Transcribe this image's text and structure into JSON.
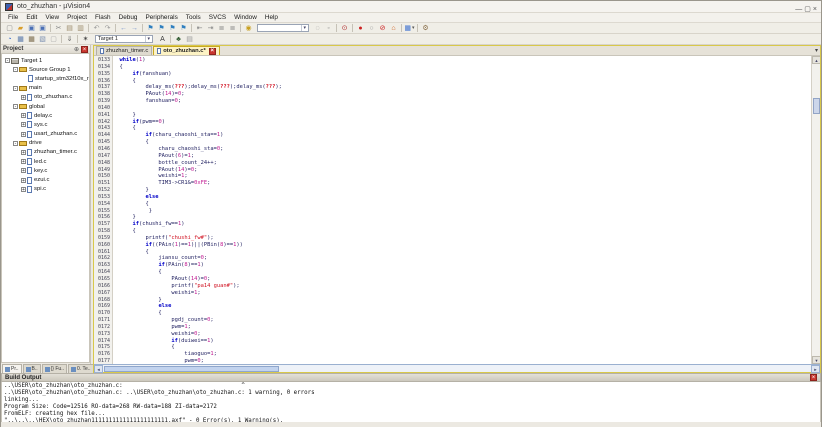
{
  "window": {
    "title": "oto_zhuzhan - µVision4",
    "controls": [
      {
        "name": "minimize",
        "glyph": "—"
      },
      {
        "name": "restore",
        "glyph": "▢"
      },
      {
        "name": "close",
        "glyph": "×"
      }
    ]
  },
  "menu": {
    "items": [
      "File",
      "Edit",
      "View",
      "Project",
      "Flash",
      "Debug",
      "Peripherals",
      "Tools",
      "SVCS",
      "Window",
      "Help"
    ]
  },
  "toolbar_main": {
    "icons_left": [
      {
        "name": "new-file",
        "glyph": "▢",
        "color": "#8a8a8a"
      },
      {
        "name": "open-folder",
        "glyph": "▰",
        "color": "#d99e2b"
      },
      {
        "name": "save",
        "glyph": "▣",
        "color": "#4a6fb5"
      },
      {
        "name": "save-all",
        "glyph": "▣",
        "color": "#4a6fb5"
      },
      {
        "sep": true
      },
      {
        "name": "cut",
        "glyph": "✂",
        "color": "#8a8a8a"
      },
      {
        "name": "copy",
        "glyph": "▤",
        "color": "#9a8a6a"
      },
      {
        "name": "paste",
        "glyph": "▥",
        "color": "#9a8a6a"
      },
      {
        "sep": true
      },
      {
        "name": "undo",
        "glyph": "↶",
        "color": "#9a9a9a"
      },
      {
        "name": "redo",
        "glyph": "↷",
        "color": "#9a9a9a"
      },
      {
        "sep": true
      },
      {
        "name": "navigate-back",
        "glyph": "←",
        "color": "#7b96cc"
      },
      {
        "name": "navigate-forward",
        "glyph": "→",
        "color": "#7b96cc"
      },
      {
        "sep": true
      },
      {
        "name": "toggle-bookmark",
        "glyph": "⚑",
        "color": "#2f7fbf"
      },
      {
        "name": "prev-bookmark",
        "glyph": "⚑",
        "color": "#2f7fbf"
      },
      {
        "name": "next-bookmark",
        "glyph": "⚑",
        "color": "#2f7fbf"
      },
      {
        "name": "clear-bookmarks",
        "glyph": "⚑",
        "color": "#2f7fbf"
      },
      {
        "sep": true
      },
      {
        "name": "unindent",
        "glyph": "⇤",
        "color": "#8a8a8a"
      },
      {
        "name": "indent",
        "glyph": "⇥",
        "color": "#8a8a8a"
      },
      {
        "name": "comment",
        "glyph": "≣",
        "color": "#8a8a8a"
      },
      {
        "name": "uncomment",
        "glyph": "≣",
        "color": "#8a8a8a"
      },
      {
        "sep": true
      },
      {
        "name": "find-in-files",
        "glyph": "◉",
        "color": "#c8a020"
      }
    ],
    "search_value": "",
    "icons_right": [
      {
        "name": "find-next",
        "glyph": "◌",
        "color": "#8a8a8a"
      },
      {
        "name": "incremental-find",
        "glyph": "◦",
        "color": "#8a8a8a"
      },
      {
        "sep": true
      },
      {
        "name": "find",
        "glyph": "⊙",
        "color": "#b03030"
      },
      {
        "sep": true
      },
      {
        "name": "insert-breakpoint",
        "glyph": "●",
        "color": "#cc2222"
      },
      {
        "name": "disable-breakpoint",
        "glyph": "○",
        "color": "#999999"
      },
      {
        "name": "kill-all-breakpoints",
        "glyph": "⊘",
        "color": "#cc2222"
      },
      {
        "name": "debug-session",
        "glyph": "⌂",
        "color": "#d06020"
      },
      {
        "sep": true
      },
      {
        "name": "debug-windows",
        "glyph": "▦",
        "color": "#3a6fd0",
        "dropdown": true
      },
      {
        "sep": true
      },
      {
        "name": "configure",
        "glyph": "⚙",
        "color": "#8a6f4a"
      }
    ]
  },
  "toolbar_build": {
    "icons_left": [
      {
        "name": "translate-file",
        "glyph": "◔",
        "color": "#3a6fd0"
      },
      {
        "name": "build",
        "glyph": "▦",
        "color": "#5577aa"
      },
      {
        "name": "rebuild-all",
        "glyph": "▦",
        "color": "#7a6a4a"
      },
      {
        "name": "batch-build",
        "glyph": "▧",
        "color": "#7a8fb0"
      },
      {
        "name": "stop-build",
        "glyph": "▢",
        "color": "#aaaaaa"
      },
      {
        "sep": true
      },
      {
        "name": "download-flash",
        "glyph": "⇓",
        "color": "#666666"
      },
      {
        "sep": true
      },
      {
        "name": "options-for-target",
        "glyph": "✶",
        "color": "#444444"
      }
    ],
    "target_value": "Target 1",
    "icons_right": [
      {
        "name": "edit-components",
        "glyph": "A",
        "color": "#3a3a3a"
      },
      {
        "sep": true
      },
      {
        "name": "debug-target",
        "glyph": "♣",
        "color": "#355e35"
      },
      {
        "name": "pack-installer",
        "glyph": "▤",
        "color": "#999999"
      }
    ]
  },
  "project_panel": {
    "title": "Project",
    "tree": [
      {
        "label": "Target 1",
        "depth": 0,
        "icon": "target",
        "expander": "minus"
      },
      {
        "label": "Source Group 1",
        "depth": 1,
        "icon": "folder",
        "expander": "minus"
      },
      {
        "label": "startup_stm32f10x_r",
        "depth": 2,
        "icon": "file",
        "expander": null
      },
      {
        "label": "main",
        "depth": 1,
        "icon": "folder",
        "expander": "minus"
      },
      {
        "label": "oto_zhuzhan.c",
        "depth": 2,
        "icon": "file",
        "expander": "plus"
      },
      {
        "label": "global",
        "depth": 1,
        "icon": "folder",
        "expander": "minus"
      },
      {
        "label": "delay.c",
        "depth": 2,
        "icon": "file",
        "expander": "plus"
      },
      {
        "label": "sys.c",
        "depth": 2,
        "icon": "file",
        "expander": "plus"
      },
      {
        "label": "usart_zhuzhan.c",
        "depth": 2,
        "icon": "file",
        "expander": "plus"
      },
      {
        "label": "drive",
        "depth": 1,
        "icon": "folder",
        "expander": "minus"
      },
      {
        "label": "zhuzhan_timer.c",
        "depth": 2,
        "icon": "file",
        "expander": "plus"
      },
      {
        "label": "led.c",
        "depth": 2,
        "icon": "file",
        "expander": "plus"
      },
      {
        "label": "key.c",
        "depth": 2,
        "icon": "file",
        "expander": "plus"
      },
      {
        "label": "ezui.c",
        "depth": 2,
        "icon": "file",
        "expander": "plus"
      },
      {
        "label": "spi.c",
        "depth": 2,
        "icon": "file",
        "expander": "plus"
      }
    ],
    "bottom_tabs": [
      {
        "name": "project",
        "label": "Pr..",
        "active": true
      },
      {
        "name": "books",
        "label": "B..",
        "active": false
      },
      {
        "name": "functions",
        "label": "{} Fu..",
        "active": false
      },
      {
        "name": "templates",
        "label": "0. Te..",
        "active": false
      }
    ]
  },
  "editor": {
    "tabs": [
      {
        "label": "zhuzhan_timer.c",
        "active": false,
        "closable": false
      },
      {
        "label": "oto_zhuzhan.c*",
        "active": true,
        "closable": true
      }
    ],
    "tab_overflow_icon": "▾",
    "first_line": 133,
    "code_lines": [
      "  while(1)",
      "  {",
      "      if(fanshuan)",
      "      {",
      "          delay_ms(???);delay_ms(???);delay_ms(???);",
      "          PAout(14)=0;",
      "          fanshuan=0;",
      "",
      "      }",
      "      if(pwm==0)",
      "      {",
      "          if(charu_chaoshi_sta==1)",
      "          {",
      "              charu_chaoshi_sta=0;",
      "              PAout(6)=1;",
      "              bottle_count_24++;",
      "              PAout(14)=0;",
      "              weishi=1;",
      "              TIM3->CR1&=0xFE;",
      "          }",
      "          else",
      "          {",
      "           }",
      "      }",
      "      if(chushi_fw==1)",
      "      {",
      "          printf(\"chushi_fw#\");",
      "          if((PAin(1)==1)||(PBin(8)==1))",
      "          {",
      "              jiansu_count=0;",
      "              if(PAin(8)==1)",
      "              {",
      "                  PAout(14)=0;",
      "                  printf(\"pa14 guan#\");",
      "                  weishi=1;",
      "              }",
      "              else",
      "              {",
      "                  pgdj_count=0;",
      "                  pwm=1;",
      "                  weishi=0;",
      "                  if(duiwei==1)",
      "                  {",
      "                      tiaoguo=1;",
      "                      pwm=0;"
    ]
  },
  "build_output": {
    "title": "Build Output",
    "lines": [
      "..\\USER\\oto_zhuzhan\\oto_zhuzhan.c:                                  ^",
      "..\\USER\\oto_zhuzhan\\oto_zhuzhan.c: ..\\USER\\oto_zhuzhan\\oto_zhuzhan.c: 1 warning, 0 errors",
      "linking...",
      "Program Size: Code=12516 RO-data=268 RW-data=188 ZI-data=2172",
      "FromELF: creating hex file...",
      "\"..\\..\\..\\HEX\\oto_zhuzhan1111111111111111111111.axf\" - 0 Error(s), 1 Warning(s)."
    ]
  },
  "colors": {
    "keyword": "#0000c8",
    "plain": "#1d1d5e",
    "string": "#d01020",
    "number": "#c01890",
    "active_tab_bg": "#fdf3c4",
    "close_button": "#c8362e"
  }
}
